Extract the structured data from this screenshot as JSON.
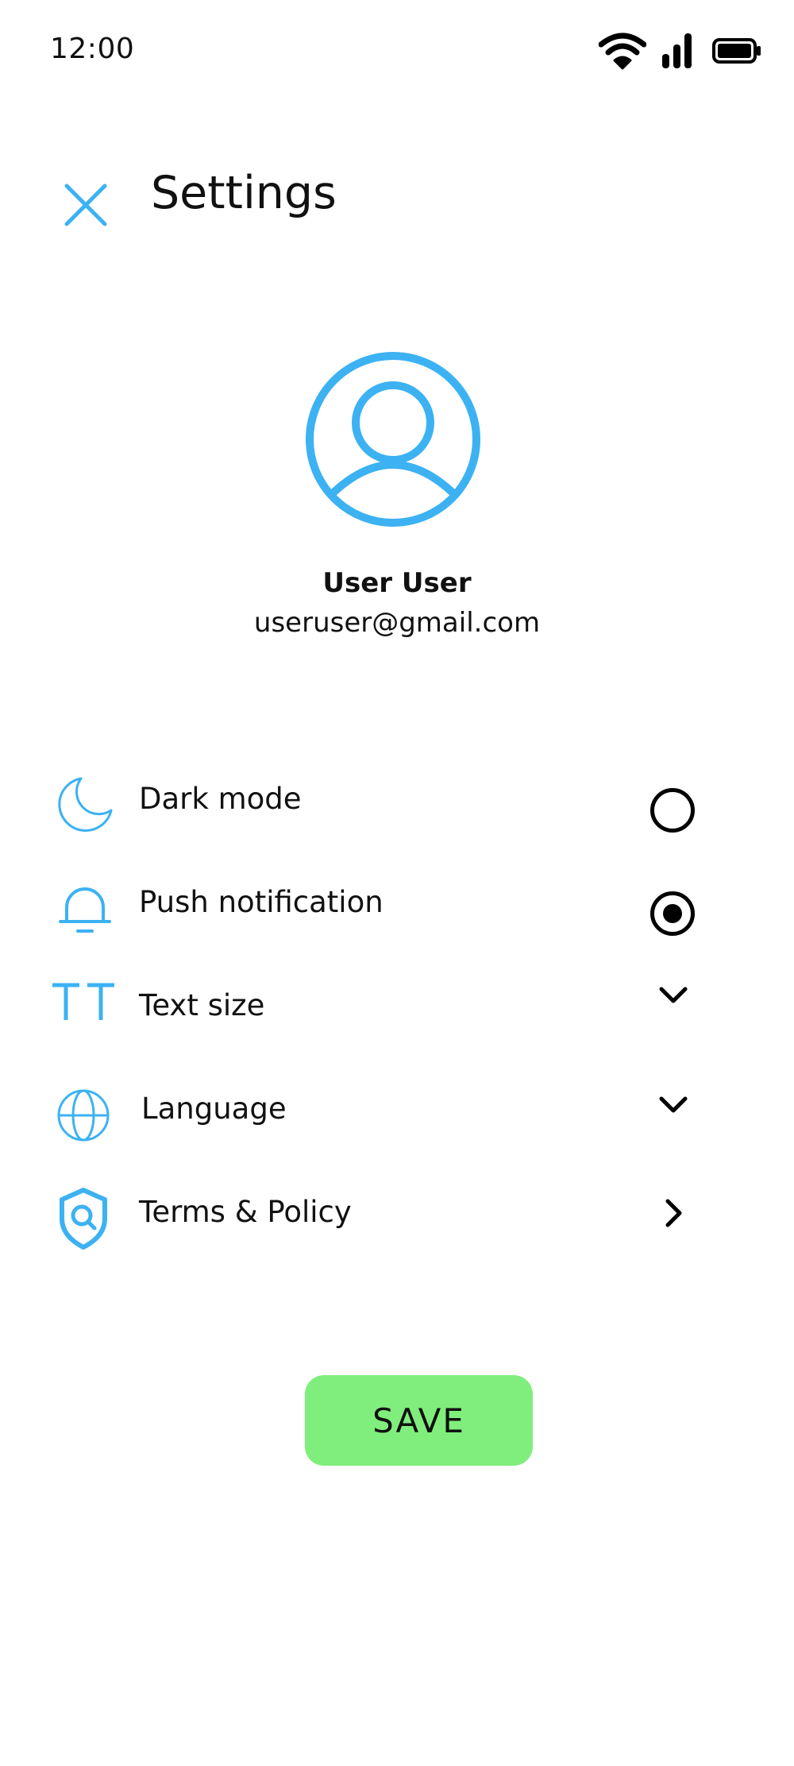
{
  "status_bar": {
    "time": "12:00",
    "icons": [
      "wifi-icon",
      "cellular-signal-icon",
      "battery-icon"
    ]
  },
  "header": {
    "close_icon": "close-icon",
    "title": "Settings"
  },
  "profile": {
    "avatar_icon": "user-circle-icon",
    "name": "User User",
    "email": "useruser@gmail.com"
  },
  "settings": {
    "items": [
      {
        "icon": "moon-icon",
        "label": "Dark mode",
        "control": "radio",
        "selected": false
      },
      {
        "icon": "bell-icon",
        "label": "Push notification",
        "control": "radio",
        "selected": true
      },
      {
        "icon": "text-size-icon",
        "label": "Text size",
        "control": "chevron-down"
      },
      {
        "icon": "globe-icon",
        "label": "Language",
        "control": "chevron-down"
      },
      {
        "icon": "shield-search-icon",
        "label": "Terms & Policy",
        "control": "chevron-right"
      }
    ]
  },
  "save_button": {
    "label": "SAVE"
  },
  "colors": {
    "accent": "#3cb2f3",
    "save_button": "#80ee7c",
    "text": "#111111",
    "background": "#ffffff"
  }
}
